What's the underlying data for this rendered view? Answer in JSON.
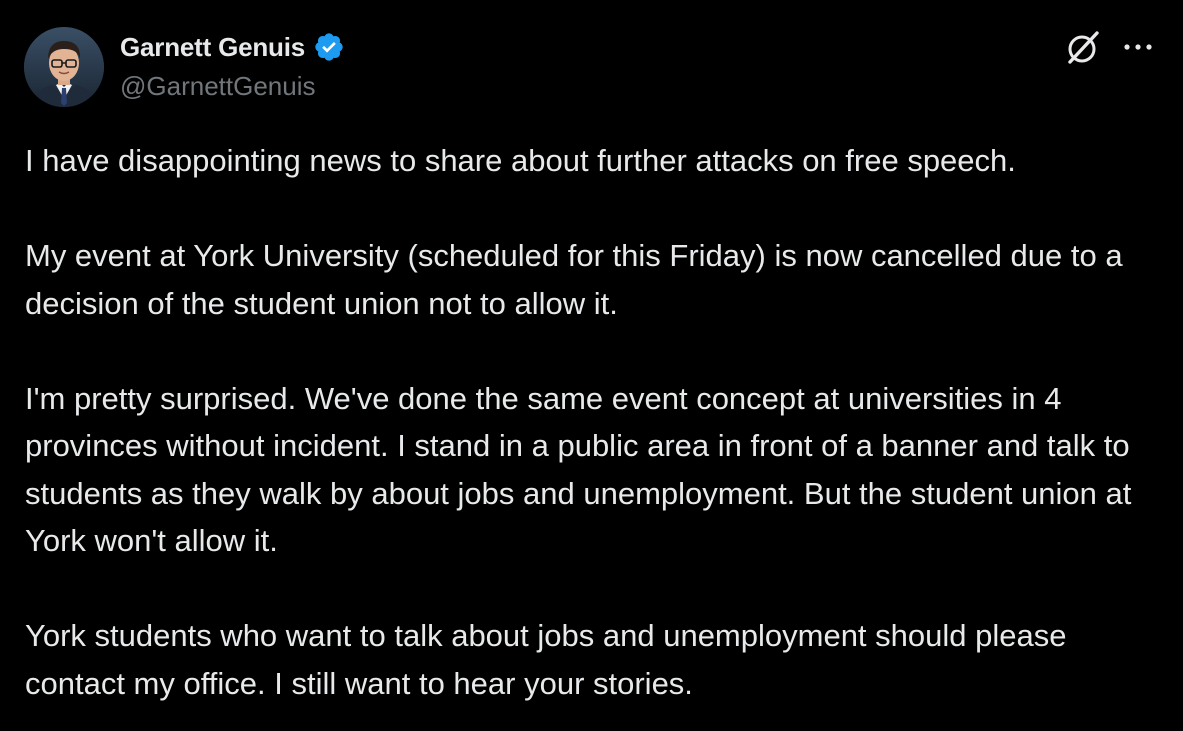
{
  "author": {
    "display_name": "Garnett Genuis",
    "handle": "@GarnettGenuis",
    "verified": true,
    "verified_color": "#1d9bf0",
    "avatar_icon": "profile-photo"
  },
  "actions": {
    "grok_icon": "grok-icon",
    "more_icon": "more-dots-icon"
  },
  "tweet": {
    "paragraphs": [
      "I have disappointing news to share about further attacks on free speech.",
      "My event at York University (scheduled for this Friday) is now cancelled due to a decision of the student union not to allow it.",
      "I'm pretty surprised. We've done the same event concept at universities in 4 provinces without incident. I stand in a public area in front of a banner and talk to students as they walk by about jobs and unemployment. But the student union at York won't allow it.",
      "York students who want to talk about jobs and unemployment should please contact my office. I still want to hear your stories."
    ]
  },
  "colors": {
    "background": "#000000",
    "text_primary": "#e7e9ea",
    "text_secondary": "#71767b"
  }
}
